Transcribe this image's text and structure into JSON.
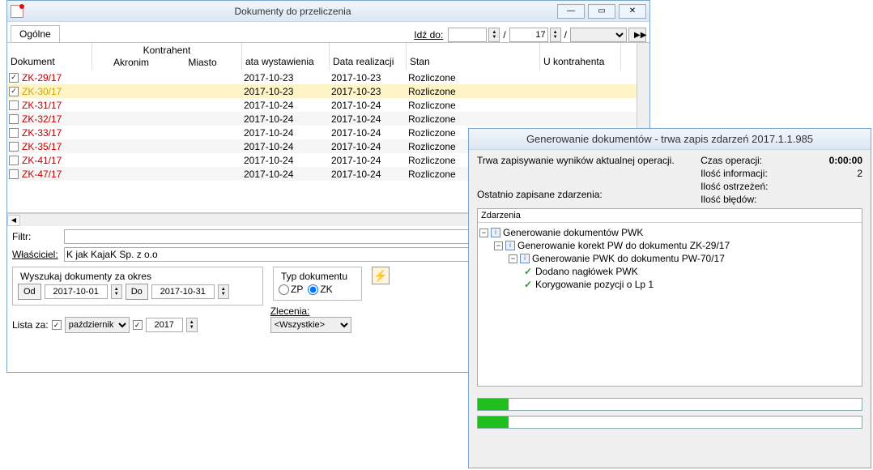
{
  "win1": {
    "title": "Dokumenty do przeliczenia",
    "tab_label": "Ogólne",
    "goto_label": "Idź do:",
    "goto_day": "",
    "goto_month": "17",
    "headers": {
      "dokument": "Dokument",
      "kontrahent": "Kontrahent",
      "akronim": "Akronim",
      "miasto": "Miasto",
      "data_wyst": "ata wystawienia",
      "data_real": "Data realizacji",
      "stan": "Stan",
      "u_kontr": "U kontrahenta"
    },
    "rows": [
      {
        "doc": "ZK-29/17",
        "checked": true,
        "selected": false,
        "wyst": "2017-10-23",
        "real": "2017-10-23",
        "stan": "Rozliczone"
      },
      {
        "doc": "ZK-30/17",
        "checked": true,
        "selected": true,
        "wyst": "2017-10-23",
        "real": "2017-10-23",
        "stan": "Rozliczone"
      },
      {
        "doc": "ZK-31/17",
        "checked": false,
        "selected": false,
        "wyst": "2017-10-24",
        "real": "2017-10-24",
        "stan": "Rozliczone"
      },
      {
        "doc": "ZK-32/17",
        "checked": false,
        "selected": false,
        "wyst": "2017-10-24",
        "real": "2017-10-24",
        "stan": "Rozliczone"
      },
      {
        "doc": "ZK-33/17",
        "checked": false,
        "selected": false,
        "wyst": "2017-10-24",
        "real": "2017-10-24",
        "stan": "Rozliczone"
      },
      {
        "doc": "ZK-35/17",
        "checked": false,
        "selected": false,
        "wyst": "2017-10-24",
        "real": "2017-10-24",
        "stan": "Rozliczone"
      },
      {
        "doc": "ZK-41/17",
        "checked": false,
        "selected": false,
        "wyst": "2017-10-24",
        "real": "2017-10-24",
        "stan": "Rozliczone"
      },
      {
        "doc": "ZK-47/17",
        "checked": false,
        "selected": false,
        "wyst": "2017-10-24",
        "real": "2017-10-24",
        "stan": "Rozliczone"
      }
    ],
    "filtr_label": "Filtr:",
    "filtr_value": "",
    "owner_label": "Właściciel:",
    "owner_value": "K jak KajaK Sp. z o.o",
    "period_legend": "Wyszukaj dokumenty za okres",
    "od_label": "Od",
    "od_value": "2017-10-01",
    "do_label": "Do",
    "do_value": "2017-10-31",
    "typ_legend": "Typ dokumentu",
    "typ_zp_label": "ZP",
    "typ_zk_label": "ZK",
    "typ_selected": "ZK",
    "zlecenia_label": "Zlecenia:",
    "zlecenia_value": "<Wszystkie>",
    "lista_za_label": "Lista za:",
    "lista_month": "październik",
    "lista_year": "2017"
  },
  "win2": {
    "title": "Generowanie dokumentów - trwa zapis zdarzeń 2017.1.1.985",
    "left_text": "Trwa zapisywanie wyników aktualnej operacji.",
    "czas_label": "Czas operacji:",
    "czas_value": "0:00:00",
    "info_label": "Ilość informacji:",
    "info_value": "2",
    "warn_label": "Ilość ostrzeżeń:",
    "warn_value": "",
    "err_label": "Ilość błędów:",
    "err_value": "",
    "events_label": "Ostatnio zapisane zdarzenia:",
    "events_header": "Zdarzenia",
    "tree": {
      "n1": "Generowanie dokumentów PWK",
      "n2": "Generowanie korekt PW do dokumentu ZK-29/17",
      "n3": "Generowanie PWK do dokumentu PW-70/17",
      "n4": "Dodano nagłówek PWK",
      "n5": "Korygowanie pozycji o Lp 1"
    },
    "progress1": 8,
    "progress2": 8
  }
}
